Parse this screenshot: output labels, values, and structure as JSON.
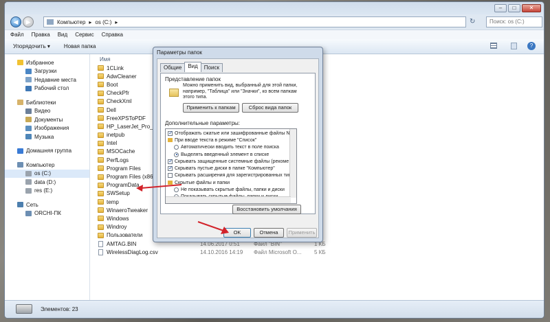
{
  "titlebar": {
    "minimize": "–",
    "maximize": "□",
    "close": "✕"
  },
  "address": {
    "back": "◀",
    "forward": "▶",
    "path": [
      "Компьютер",
      "▸",
      "os (C:)",
      "▸"
    ],
    "refresh": "↻",
    "search_placeholder": "Поиск: os (C:)"
  },
  "menu": [
    "Файл",
    "Правка",
    "Вид",
    "Сервис",
    "Справка"
  ],
  "toolbar": {
    "organize": "Упорядочить ▾",
    "new_folder": "Новая папка"
  },
  "navpane": {
    "items": [
      {
        "label": "Избранное",
        "icon": "star-icon",
        "color": "#f1c232",
        "indent": 0
      },
      {
        "label": "Загрузки",
        "icon": "downloads-icon",
        "color": "#4a86c5",
        "indent": 1
      },
      {
        "label": "Недавние места",
        "icon": "recent-icon",
        "color": "#7ea3c9",
        "indent": 1
      },
      {
        "label": "Рабочий стол",
        "icon": "desktop-icon",
        "color": "#3f78b5",
        "indent": 1
      },
      {
        "gap": true
      },
      {
        "label": "Библиотеки",
        "icon": "library-icon",
        "color": "#d7b36a",
        "indent": 0
      },
      {
        "label": "Видео",
        "icon": "video-icon",
        "color": "#6b7f99",
        "indent": 1
      },
      {
        "label": "Документы",
        "icon": "documents-icon",
        "color": "#c8a955",
        "indent": 1
      },
      {
        "label": "Изображения",
        "icon": "images-icon",
        "color": "#5a8fc0",
        "indent": 1
      },
      {
        "label": "Музыка",
        "icon": "music-icon",
        "color": "#4e86b8",
        "indent": 1
      },
      {
        "gap": true
      },
      {
        "label": "Домашняя группа",
        "icon": "homegroup-icon",
        "color": "#3a7bd5",
        "indent": 0
      },
      {
        "gap": true
      },
      {
        "label": "Компьютер",
        "icon": "computer-icon",
        "color": "#6d8fb3",
        "indent": 0
      },
      {
        "label": "os (C:)",
        "icon": "drive-icon",
        "color": "#9aa3ad",
        "indent": 1,
        "selected": true
      },
      {
        "label": "data (D:)",
        "icon": "drive-icon",
        "color": "#9aa3ad",
        "indent": 1
      },
      {
        "label": "res (E:)",
        "icon": "drive-icon",
        "color": "#9aa3ad",
        "indent": 1
      },
      {
        "gap": true
      },
      {
        "label": "Сеть",
        "icon": "network-icon",
        "color": "#4d7fae",
        "indent": 0
      },
      {
        "label": "ORCHI-ПК",
        "icon": "pc-icon",
        "color": "#6d8fb3",
        "indent": 1
      }
    ]
  },
  "files": {
    "header": "Имя",
    "folders": [
      "1CLink",
      "AdwCleaner",
      "Boot",
      "CheckPfr",
      "CheckXml",
      "Dell",
      "FreeXPSToPDF",
      "HP_LaserJet_Pro_MFP_",
      "inetpub",
      "Intel",
      "MSOCache",
      "PerfLogs",
      "Program Files",
      "Program Files (x86)",
      "ProgramData",
      "SWSetup",
      "temp",
      "WinaeroTweaker",
      "Windows",
      "Windroy",
      "Пользователи"
    ],
    "documents": [
      {
        "name": "AMTAG.BIN",
        "date": "14.06.2017 0:51",
        "type": "Файл \"BIN\"",
        "size": "1 КБ"
      },
      {
        "name": "WirelessDiagLog.csv",
        "date": "14.10.2016 14:19",
        "type": "Файл Microsoft O...",
        "size": "5 КБ"
      }
    ]
  },
  "status": {
    "items_count": "Элементов: 23"
  },
  "dialog": {
    "title": "Параметры папок",
    "tabs": [
      "Общие",
      "Вид",
      "Поиск"
    ],
    "folder_view_label": "Представление папок",
    "folder_view_text": "Можно применить вид, выбранный для этой папки, например, \"Таблица\" или \"Значки\", ко всем папкам этого типа.",
    "apply_to_folders": "Применить к папкам",
    "reset_folders": "Сброс вида папок",
    "advanced_label": "Дополнительные параметры:",
    "options": [
      {
        "kind": "checkbox",
        "checked": true,
        "text": "Отображать сжатые или зашифрованные файлы NTI",
        "indent": 1
      },
      {
        "kind": "folder",
        "text": "При вводе текста в режиме \"Список\"",
        "indent": 1
      },
      {
        "kind": "radio",
        "checked": false,
        "text": "Автоматически вводить текст в поле поиска",
        "indent": 2
      },
      {
        "kind": "radio",
        "checked": true,
        "text": "Выделять введенный элемент в списке",
        "indent": 2
      },
      {
        "kind": "checkbox",
        "checked": true,
        "text": "Скрывать защищенные системные файлы (рекоме",
        "indent": 1
      },
      {
        "kind": "checkbox",
        "checked": true,
        "text": "Скрывать пустые диски в папке \"Компьютер\"",
        "indent": 1
      },
      {
        "kind": "checkbox",
        "checked": false,
        "text": "Скрывать расширения для зарегистрированных типо",
        "indent": 1
      },
      {
        "kind": "folder",
        "text": "Скрытые файлы и папки",
        "indent": 1
      },
      {
        "kind": "radio",
        "checked": false,
        "text": "Не показывать скрытые файлы, папки и диски",
        "indent": 2
      },
      {
        "kind": "radio",
        "checked": true,
        "text": "Показывать скрытые файлы, папки и диски",
        "indent": 2
      }
    ],
    "restore_defaults": "Восстановить умолчания",
    "ok": "OK",
    "cancel": "Отмена",
    "apply": "Применить"
  },
  "annotation_color": "#d2232a"
}
